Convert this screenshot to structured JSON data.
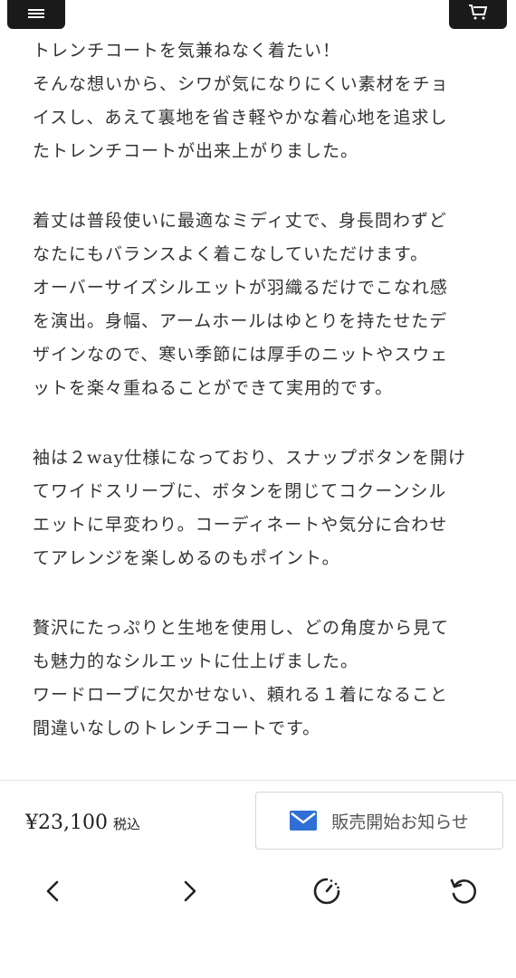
{
  "header": {
    "menu_icon": "hamburger-menu-icon",
    "cart_icon": "cart-icon"
  },
  "description": {
    "paragraphs": [
      {
        "lines": [
          "トレンチコートを気兼ねなく着たい！",
          "そんな想いから、シワが気になりにくい素材をチョ",
          "イスし、あえて裏地を省き軽やかな着心地を追求し",
          "たトレンチコートが出来上がりました。"
        ]
      },
      {
        "lines": [
          "着丈は普段使いに最適なミディ丈で、身長問わずど",
          "なたにもバランスよく着こなしていただけます。",
          "オーバーサイズシルエットが羽織るだけでこなれ感",
          "を演出。身幅、アームホールはゆとりを持たせたデ",
          "ザインなので、寒い季節には厚手のニットやスウェ",
          "ットを楽々重ねることができて実用的です。"
        ]
      },
      {
        "lines": [
          "袖は２way仕様になっており、スナップボタンを開け",
          "てワイドスリーブに、ボタンを閉じてコクーンシル",
          "エットに早変わり。コーディネートや気分に合わせ",
          "てアレンジを楽しめるのもポイント。"
        ]
      },
      {
        "lines": [
          "贅沢にたっぷりと生地を使用し、どの角度から見て",
          "も魅力的なシルエットに仕上げました。",
          "ワードローブに欠かせない、頼れる１着になること",
          "間違いなしのトレンチコートです。"
        ]
      }
    ]
  },
  "purchase": {
    "price": "¥23,100",
    "tax_label": "税込",
    "notify_icon": "envelope-icon",
    "notify_label": "販売開始お知らせ"
  },
  "browser_nav": {
    "back_icon": "chevron-left-icon",
    "forward_icon": "chevron-right-icon",
    "loading_icon": "loading-spinner-icon",
    "reload_icon": "reload-icon"
  }
}
